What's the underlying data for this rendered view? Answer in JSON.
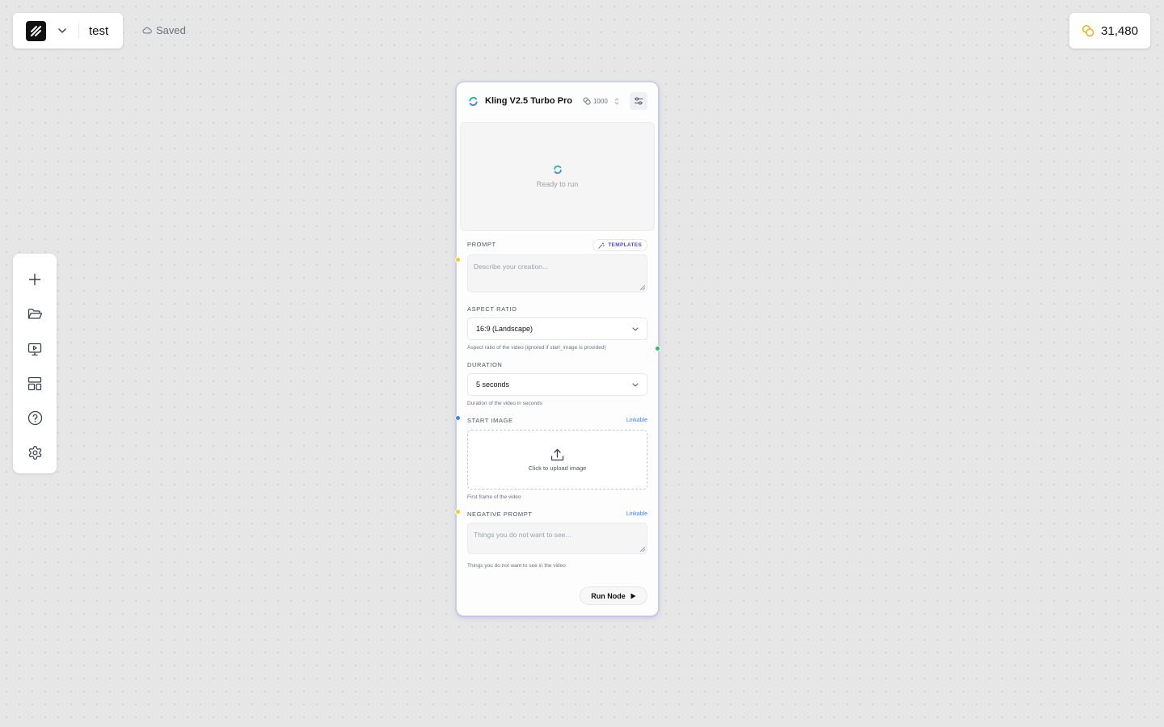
{
  "project": {
    "name": "test",
    "save_status": "Saved"
  },
  "credits": {
    "amount": "31,480",
    "icon": "coins-icon"
  },
  "toolbar": {
    "items": [
      {
        "icon": "plus-icon"
      },
      {
        "icon": "folder-open-icon"
      },
      {
        "icon": "presentation-play-icon"
      },
      {
        "icon": "layout-template-icon"
      },
      {
        "icon": "help-circle-icon"
      },
      {
        "icon": "gear-icon"
      }
    ]
  },
  "node": {
    "title": "Kling V2.5 Turbo Pro",
    "cost": "1000",
    "preview_status": "Ready to run",
    "prompt": {
      "label": "PROMPT",
      "templates_label": "TEMPLATES",
      "placeholder": "Describe your creation..."
    },
    "aspect_ratio": {
      "label": "ASPECT RATIO",
      "value": "16:9 (Landscape)",
      "hint": "Aspect ratio of the video (ignored if start_image is provided)"
    },
    "duration": {
      "label": "DURATION",
      "value": "5 seconds",
      "hint": "Duration of the video in seconds"
    },
    "start_image": {
      "label": "START IMAGE",
      "linkable": "Linkable",
      "upload_text": "Click to upload image",
      "hint": "First frame of the video"
    },
    "negative_prompt": {
      "label": "NEGATIVE PROMPT",
      "linkable": "Linkable",
      "placeholder": "Things you do not want to see...",
      "hint": "Things you do not want to see in the video"
    },
    "run_label": "Run Node"
  },
  "colors": {
    "accent": "#4f46e5",
    "link": "#3b82f6",
    "handle_yellow": "#facc15",
    "handle_green": "#22c55e",
    "handle_blue": "#3b82f6",
    "coin": "#eab308"
  }
}
